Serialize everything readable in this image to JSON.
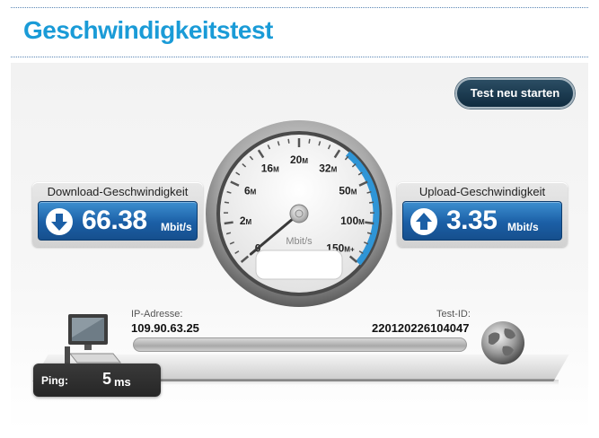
{
  "header": {
    "title": "Geschwindigkeitstest"
  },
  "toolbar": {
    "restart_label": "Test neu starten"
  },
  "download": {
    "label": "Download-Geschwindigkeit",
    "value": "66.38",
    "unit": "Mbit/s",
    "icon": "arrow-down-icon"
  },
  "upload": {
    "label": "Upload-Geschwindigkeit",
    "value": "3.35",
    "unit": "Mbit/s",
    "icon": "arrow-up-icon"
  },
  "gauge": {
    "unit": "Mbit/s",
    "scale": [
      {
        "value": "0",
        "suffix": ""
      },
      {
        "value": "2",
        "suffix": "M"
      },
      {
        "value": "6",
        "suffix": "M"
      },
      {
        "value": "16",
        "suffix": "M"
      },
      {
        "value": "20",
        "suffix": "M"
      },
      {
        "value": "32",
        "suffix": "M"
      },
      {
        "value": "50",
        "suffix": "M"
      },
      {
        "value": "100",
        "suffix": "M"
      },
      {
        "value": "150",
        "suffix": "M+"
      }
    ],
    "needle_value": 0,
    "arc_color": "#2f95d6",
    "readout": ""
  },
  "connection": {
    "ip_label": "IP-Adresse:",
    "ip_value": "109.90.63.25",
    "test_id_label": "Test-ID:",
    "test_id_value": "220120226104047"
  },
  "ping": {
    "label": "Ping:",
    "value": "5",
    "unit": "ms"
  },
  "colors": {
    "title": "#1a9bd7",
    "speed_display": "#1b5fa6",
    "button": "#0f2b3f"
  }
}
